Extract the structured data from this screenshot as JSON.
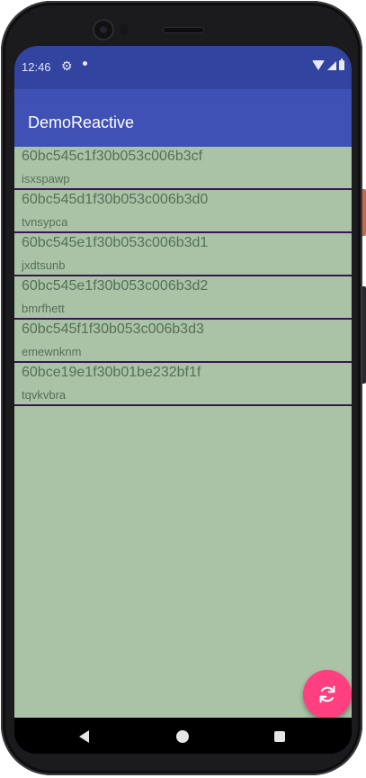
{
  "status_bar": {
    "time": "12:46",
    "notification_icons": [
      "gear-icon",
      "dot-icon"
    ],
    "system_icons": [
      "wifi-icon",
      "signal-icon",
      "battery-icon"
    ]
  },
  "app_bar": {
    "title": "DemoReactive",
    "color": "#3f51b5"
  },
  "list": {
    "background": "#aac3a6",
    "divider_color": "#3a1552",
    "items": [
      {
        "id": "60bc545c1f30b053c006b3cf",
        "name": "isxspawp"
      },
      {
        "id": "60bc545d1f30b053c006b3d0",
        "name": "tvnsypca"
      },
      {
        "id": "60bc545e1f30b053c006b3d1",
        "name": "jxdtsunb"
      },
      {
        "id": "60bc545e1f30b053c006b3d2",
        "name": "bmrfhett"
      },
      {
        "id": "60bc545f1f30b053c006b3d3",
        "name": "emewnknm"
      },
      {
        "id": "60bce19e1f30b01be232bf1f",
        "name": "tqvkvbra"
      }
    ]
  },
  "fab": {
    "icon": "refresh-icon",
    "color": "#ff3f7f"
  },
  "nav_bar": {
    "icons": [
      "back-icon",
      "home-icon",
      "recents-icon"
    ]
  }
}
